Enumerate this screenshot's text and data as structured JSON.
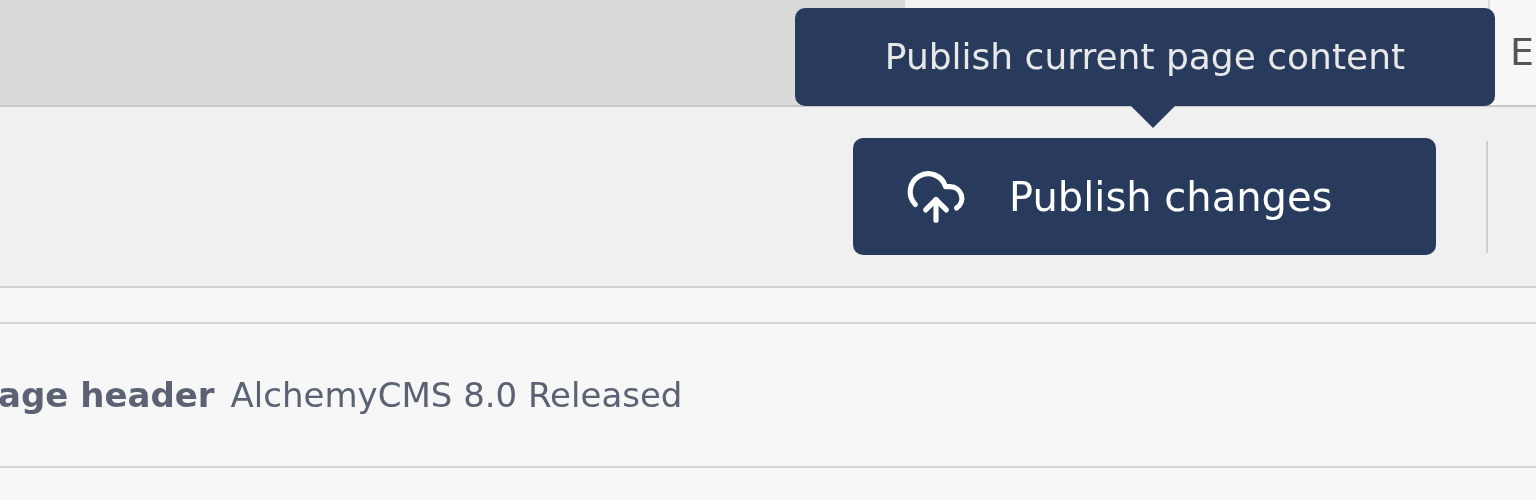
{
  "top_bar": {
    "edge_label": "E"
  },
  "tooltip": {
    "text": "Publish current page content"
  },
  "toolbar": {
    "publish_button": {
      "label": "Publish changes"
    }
  },
  "element_row": {
    "name": "age header",
    "title": "AlchemyCMS 8.0 Released"
  }
}
